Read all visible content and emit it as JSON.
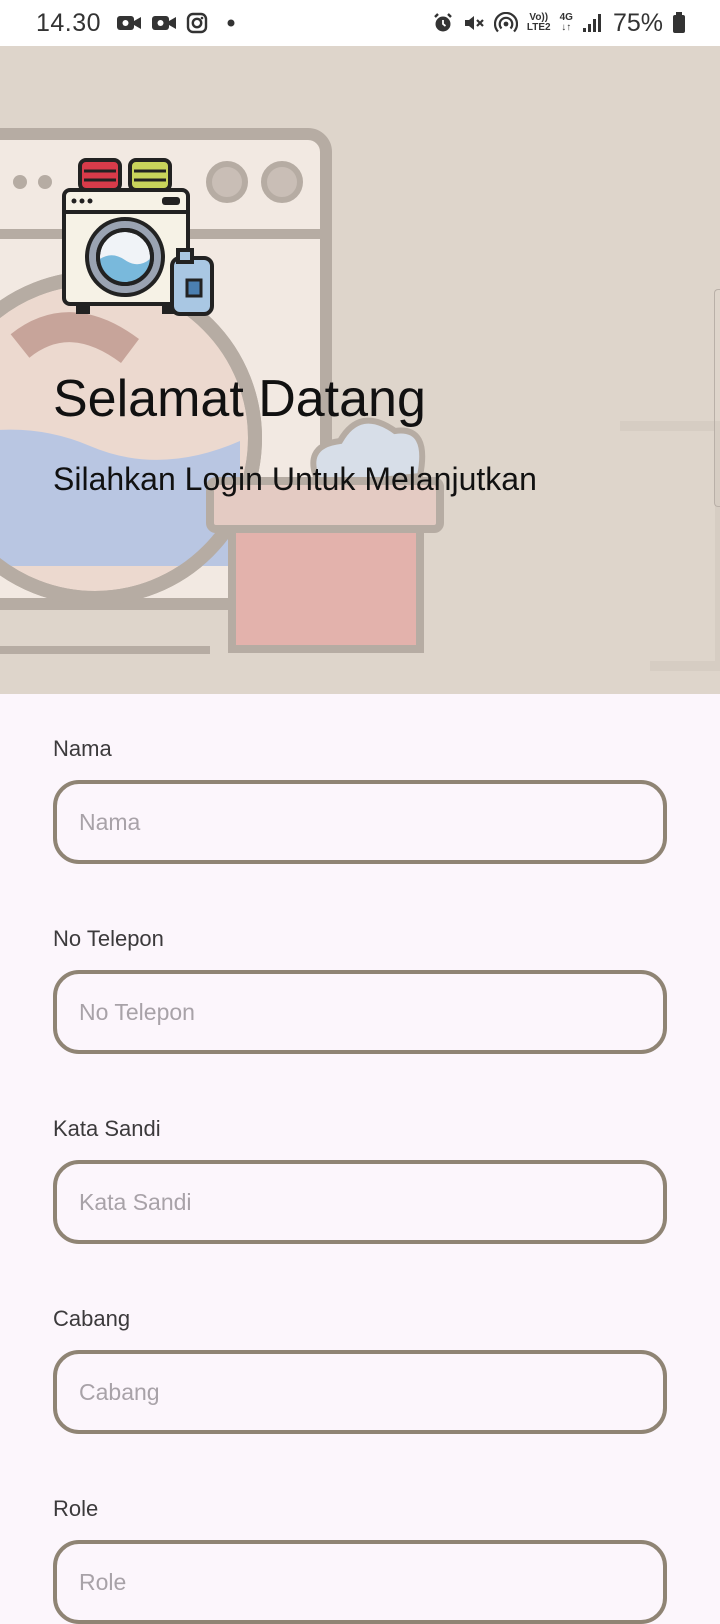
{
  "status_bar": {
    "time": "14.30",
    "battery": "75%",
    "volte": "Vo))\nLTE2",
    "network": "4G",
    "left_icons": [
      "video-icon",
      "video-icon",
      "instagram-icon",
      "dot-icon"
    ],
    "right_icons": [
      "alarm-icon",
      "mute-icon",
      "hotspot-icon",
      "volte-icon",
      "network-4g-icon",
      "signal-icon",
      "battery-icon"
    ]
  },
  "hero": {
    "title": "Selamat Datang",
    "subtitle": "Silahkan Login Untuk Melanjutkan",
    "logo_icon": "washing-machine-icon",
    "background": "laundry-illustration"
  },
  "form": {
    "fields": [
      {
        "label": "Nama",
        "placeholder": "Nama",
        "value": ""
      },
      {
        "label": "No Telepon",
        "placeholder": "No Telepon",
        "value": ""
      },
      {
        "label": "Kata Sandi",
        "placeholder": "Kata Sandi",
        "value": ""
      },
      {
        "label": "Cabang",
        "placeholder": "Cabang",
        "value": ""
      },
      {
        "label": "Role",
        "placeholder": "Role",
        "value": ""
      }
    ]
  },
  "colors": {
    "hero_bg": "#ded5cb",
    "page_bg": "#fcf6fc",
    "input_border": "#8f8474",
    "placeholder": "#a8a2a8"
  }
}
